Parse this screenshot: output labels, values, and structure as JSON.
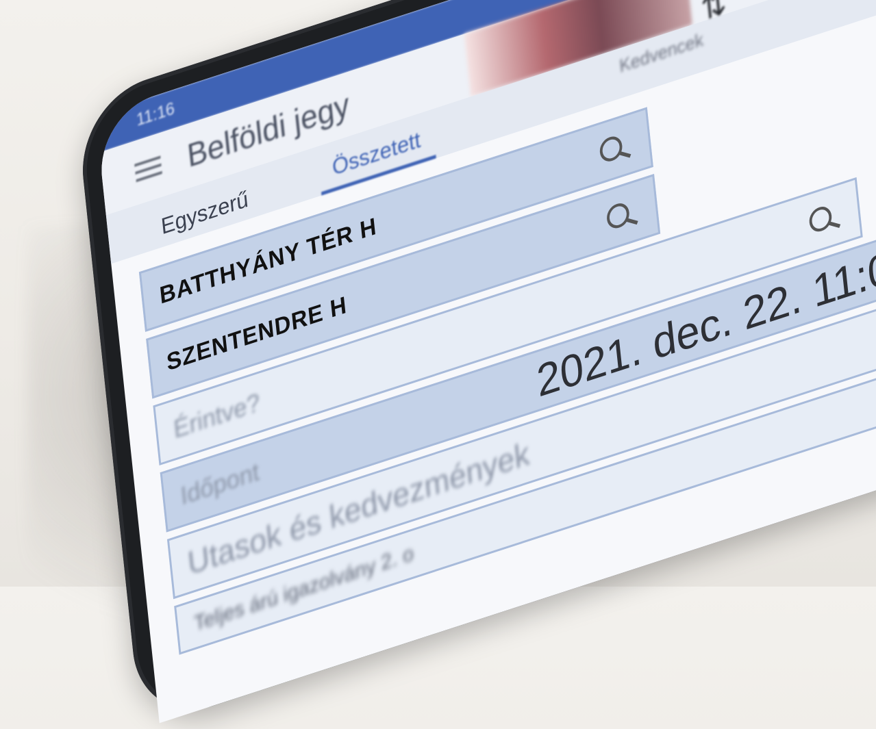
{
  "statusbar": {
    "time": "11:16"
  },
  "app": {
    "title": "Belföldi jegy",
    "favorites_label": "Kedvencek"
  },
  "tabs": [
    {
      "label": "Egyszerű"
    },
    {
      "label": "Összetett"
    }
  ],
  "form": {
    "from": "BATTHYÁNY TÉR H",
    "to": "SZENTENDRE H",
    "via_placeholder": "Érintve?",
    "datetime": "2021. dec. 22. 11:0",
    "time_label": "Időpont",
    "discounts_label": "Utasok és kedvezmények",
    "passenger_line": "Teljes árú igazolvány 2. o"
  },
  "colors": {
    "primary": "#3f63b5",
    "field_fill": "#c4d2e8",
    "field_border": "#a7bada",
    "background": "#f3f1ed"
  },
  "icons": [
    "menu-icon",
    "trash-icon",
    "close-icon",
    "swap-icon",
    "search-icon"
  ]
}
